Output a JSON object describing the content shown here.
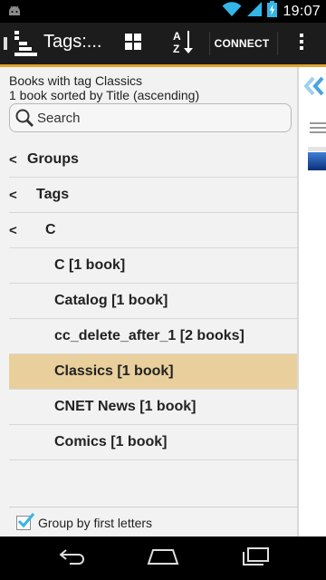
{
  "status_bar": {
    "time": "19:07"
  },
  "action_bar": {
    "title": "Tags:...",
    "connect_label": "CONNECT"
  },
  "panel": {
    "header_line1": "Books with tag Classics",
    "header_line2": "1 book sorted by Title (ascending)",
    "search_placeholder": "Search"
  },
  "tree_rows": [
    {
      "chevron": "<",
      "label": "Groups"
    },
    {
      "chevron": "<",
      "label": "Tags"
    },
    {
      "chevron": "<",
      "label": "C"
    },
    {
      "chevron": "",
      "label": "C [1 book]"
    },
    {
      "chevron": "",
      "label": "Catalog [1 book]"
    },
    {
      "chevron": "",
      "label": "cc_delete_after_1 [2 books]"
    },
    {
      "chevron": "",
      "label": "Classics [1 book]",
      "selected": true
    },
    {
      "chevron": "",
      "label": "CNET News [1 book]"
    },
    {
      "chevron": "",
      "label": "Comics [1 book]"
    }
  ],
  "footer": {
    "group_by_label": "Group by first letters",
    "group_by_checked": true
  },
  "colors": {
    "accent": "#e0a32c",
    "selected_row": "#e8cf9c",
    "checkbox_tick": "#33b5e5"
  },
  "icons": {
    "status_left": "android-icon",
    "wifi": "wifi-icon",
    "signal": "signal-icon",
    "battery": "battery-charging-icon",
    "app": "tag-browser-icon",
    "grid": "grid-view-icon",
    "sort": "sort-az-icon",
    "overflow": "overflow-menu-icon",
    "search": "search-icon",
    "back": "back-icon",
    "home": "home-icon",
    "recents": "recent-apps-icon"
  }
}
